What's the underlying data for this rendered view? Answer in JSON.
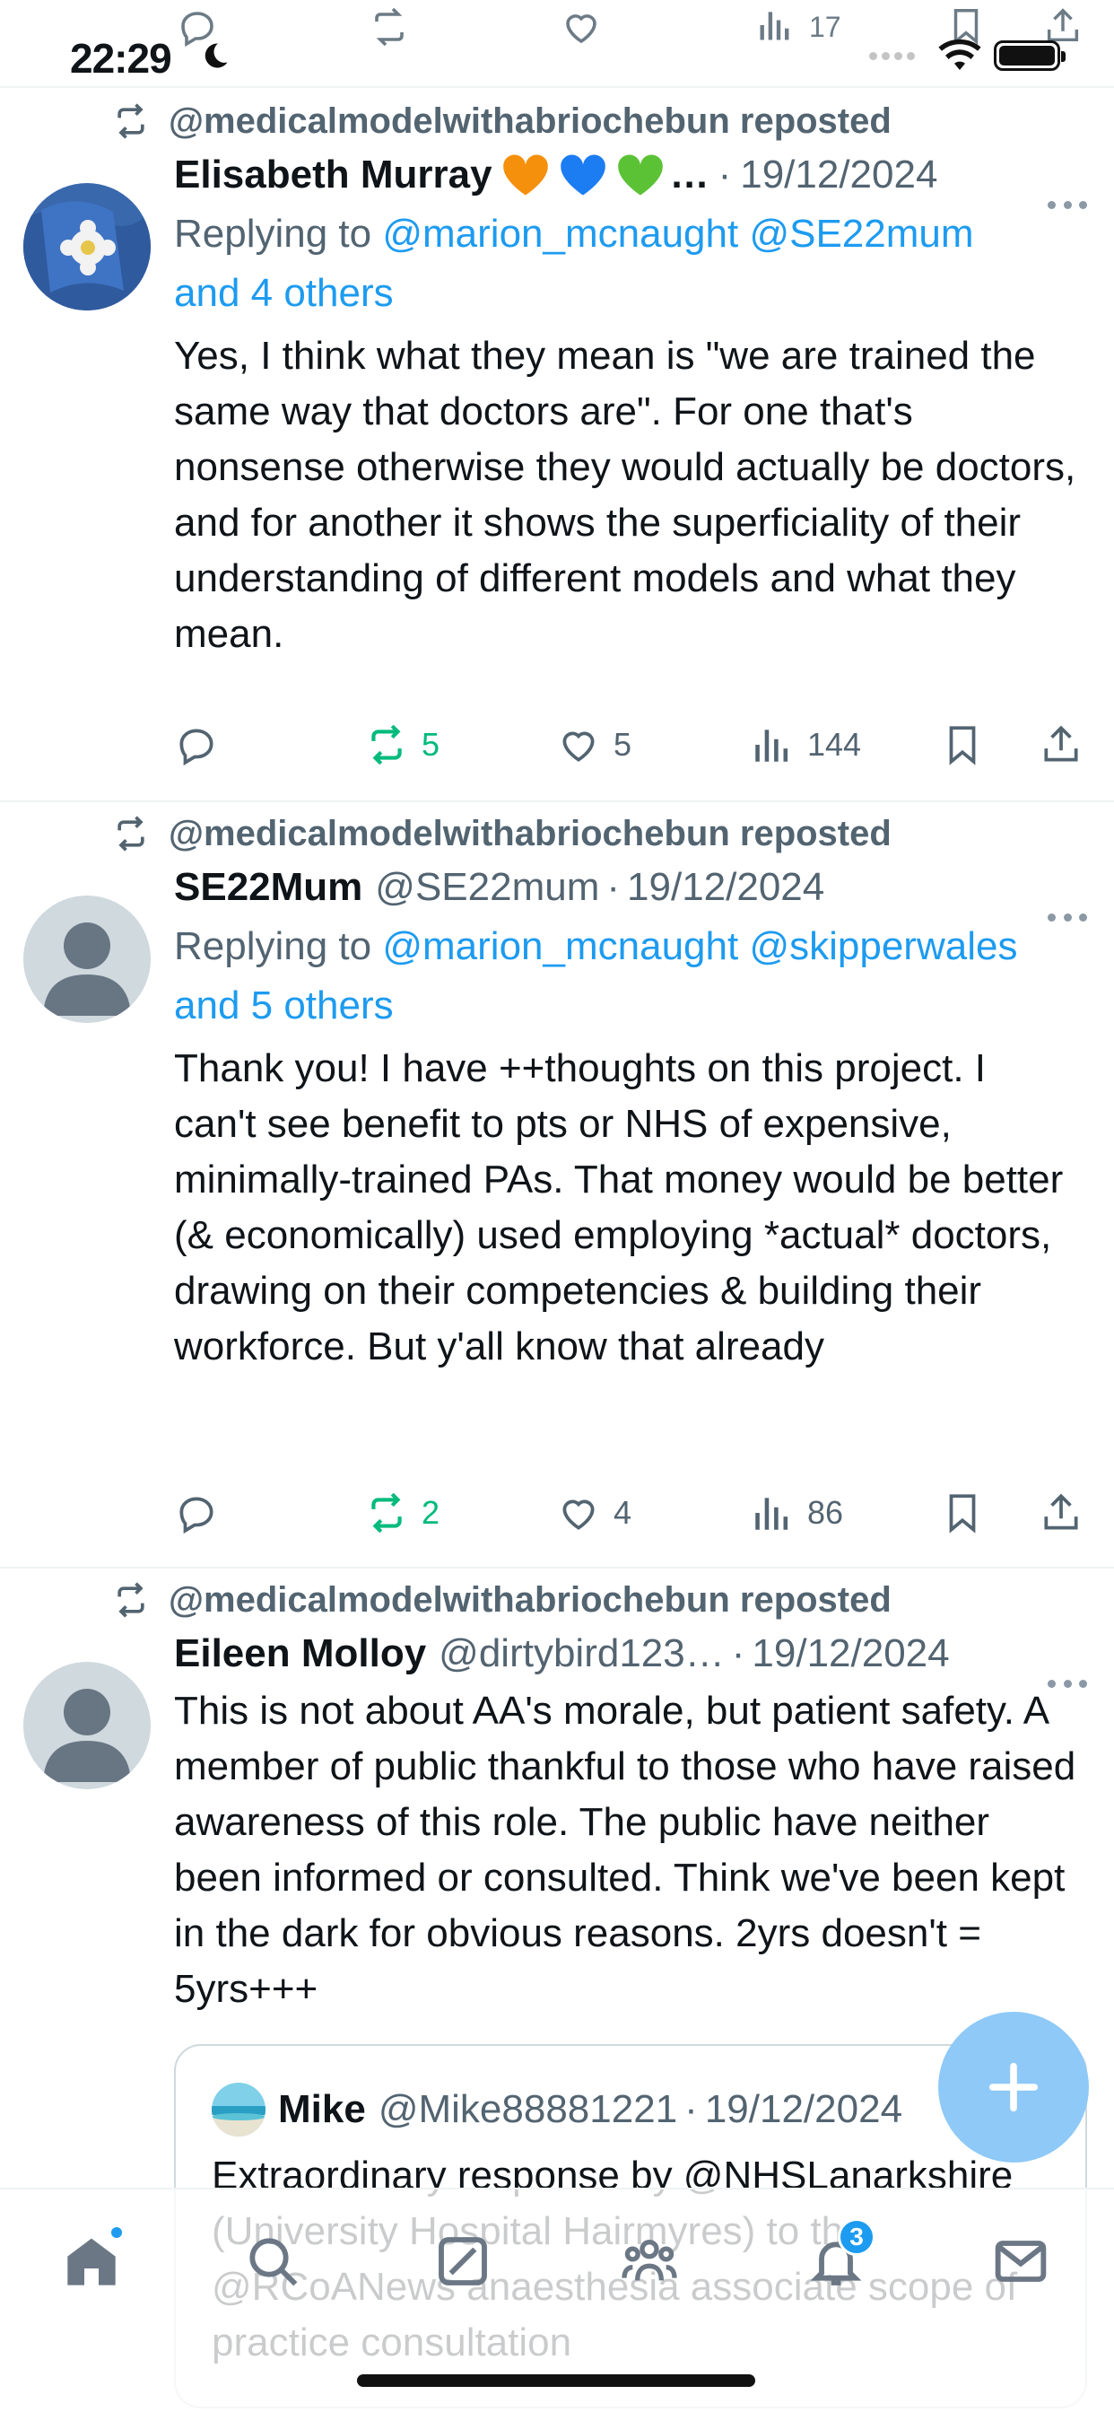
{
  "status_bar": {
    "time": "22:29",
    "icons": [
      "moon-icon",
      "signal-icon",
      "wifi-icon",
      "battery-icon"
    ],
    "ghost_views": "17"
  },
  "repost_icon_color": "#536471",
  "link_color": "#1d9bf0",
  "repost_active_color": "#00ba7c",
  "posts": [
    {
      "repost_label": "@medicalmodelwithabriochebun reposted",
      "name": "Elisabeth Murray",
      "handle": "",
      "name_suffix": "…",
      "dot": "·",
      "date": "19/12/2024",
      "reply_prefix": "Replying to ",
      "reply_links": "@marion_mcnaught @SE22mum",
      "reply_tail": "and 4 others",
      "text": "Yes, I think what they mean is \"we are trained the same way that doctors are\". For one that's nonsense otherwise they would actually be doctors, and for another it shows the superficiality of their understanding of different models and what they mean.",
      "reposts": "5",
      "likes": "5",
      "views": "144"
    },
    {
      "repost_label": "@medicalmodelwithabriochebun reposted",
      "name": "SE22Mum",
      "handle": "@SE22mum",
      "dot": "·",
      "date": "19/12/2024",
      "reply_prefix": "Replying to ",
      "reply_links": "@marion_mcnaught @skipperwales",
      "reply_tail": "and 5 others",
      "text": "Thank you! I have ++thoughts on this project. I can't see benefit to pts or NHS of expensive, minimally-trained PAs. That money would be better (& economically) used employing *actual* doctors, drawing on their competencies & building their workforce. But y'all know that already",
      "reposts": "2",
      "likes": "4",
      "views": "86"
    },
    {
      "repost_label": "@medicalmodelwithabriochebun reposted",
      "name": "Eileen Molloy",
      "handle": "@dirtybird123…",
      "dot": "·",
      "date": "19/12/2024",
      "text": "This is not about AA's morale, but patient safety. A member of public thankful to those who have raised awareness of this role. The public have neither been informed or consulted. Think we've been kept in the dark for obvious reasons. 2yrs doesn't = 5yrs+++",
      "quote": {
        "name": "Mike",
        "handle": "@Mike88881221",
        "dot": "·",
        "date": "19/12/2024",
        "text": "Extraordinary response by @NHSLanarkshire (University Hospital Hairmyres) to the @RCoANews anaesthesia associate scope of practice consultation"
      }
    }
  ],
  "fab": {
    "icon": "plus-icon"
  },
  "tabbar": {
    "tabs": [
      "home-icon",
      "search-icon",
      "grok-icon",
      "communities-icon",
      "notifications-icon",
      "messages-icon"
    ],
    "notifications_badge": "3"
  }
}
